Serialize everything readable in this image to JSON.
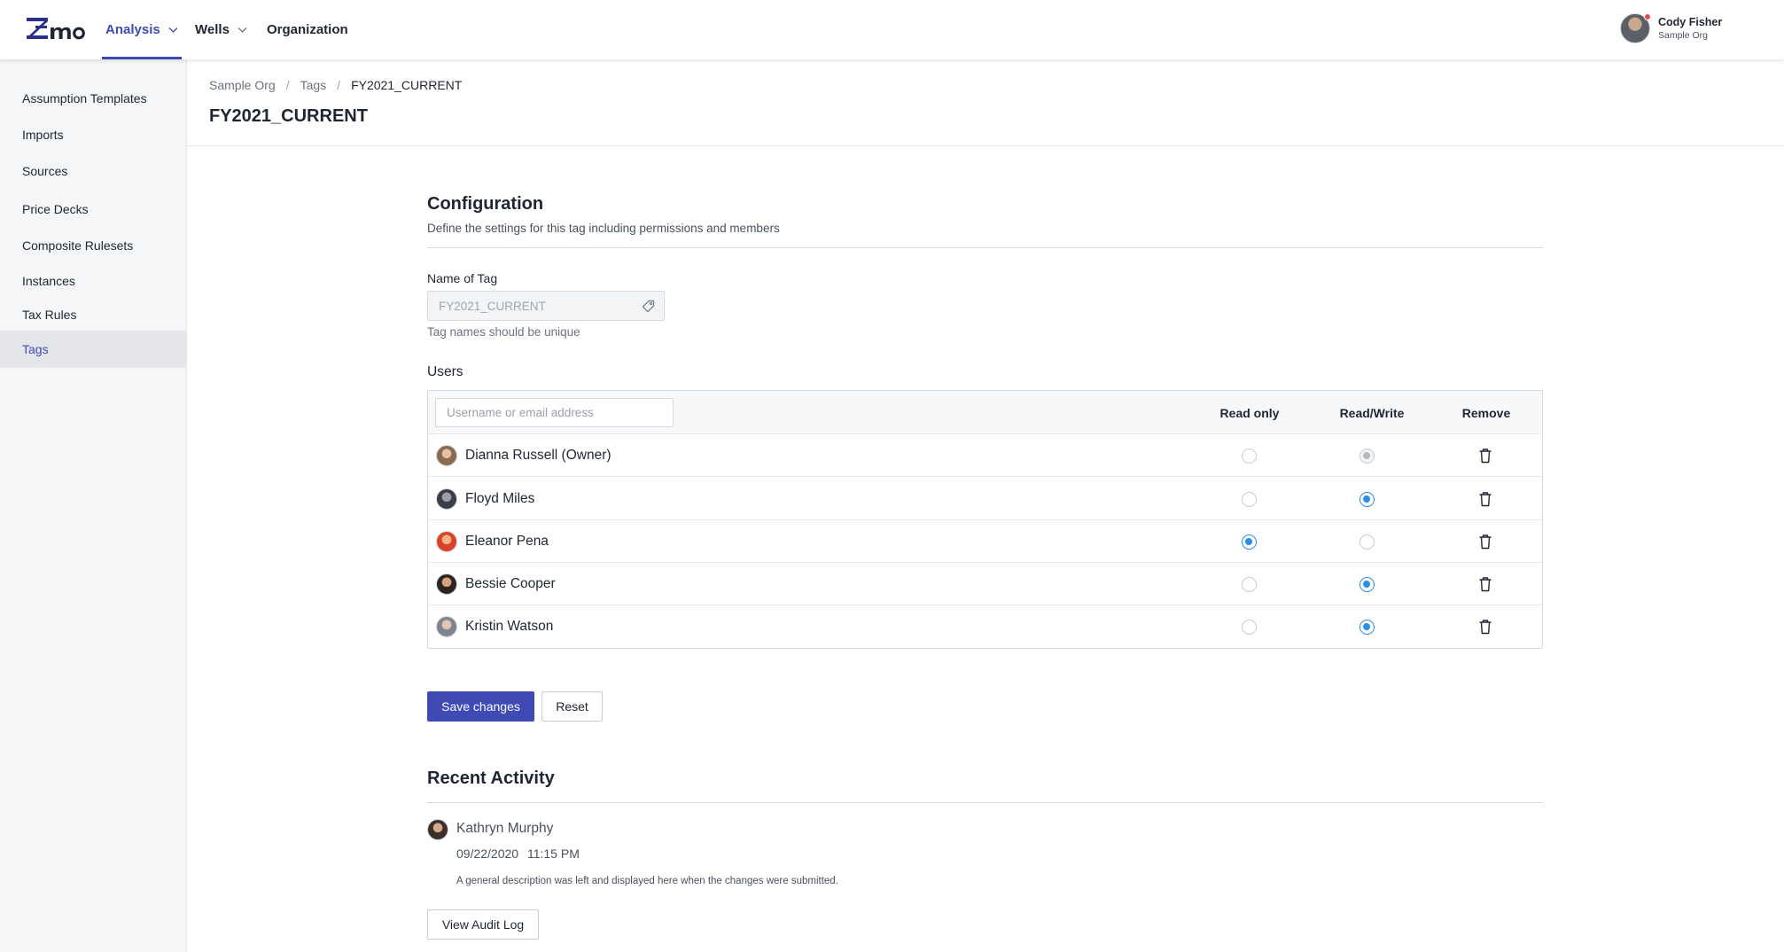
{
  "brand": {
    "logo_text": "ZEMO",
    "accent": "#3f4ab5"
  },
  "nav": {
    "items": [
      {
        "label": "Analysis",
        "has_dropdown": true,
        "active": true
      },
      {
        "label": "Wells",
        "has_dropdown": true,
        "active": false
      },
      {
        "label": "Organization",
        "has_dropdown": false,
        "active": false
      }
    ]
  },
  "user": {
    "name": "Cody Fisher",
    "org": "Sample Org",
    "has_notification": true
  },
  "sidebar": {
    "items": [
      {
        "label": "Assumption Templates",
        "active": false
      },
      {
        "label": "Imports",
        "active": false
      },
      {
        "label": "Sources",
        "active": false
      },
      {
        "label": "Price Decks",
        "active": false
      },
      {
        "label": "Composite Rulesets",
        "active": false
      },
      {
        "label": "Instances",
        "active": false
      },
      {
        "label": "Tax Rules",
        "active": false
      },
      {
        "label": "Tags",
        "active": true
      }
    ]
  },
  "breadcrumb": {
    "items": [
      "Sample Org",
      "Tags",
      "FY2021_CURRENT"
    ],
    "separator": "/"
  },
  "page": {
    "title": "FY2021_CURRENT"
  },
  "configuration": {
    "title": "Configuration",
    "subtitle": "Define the settings for this tag including permissions and members",
    "tag_name_label": "Name of Tag",
    "tag_name_value": "FY2021_CURRENT",
    "tag_name_hint": "Tag names should be unique",
    "users_label": "Users",
    "search_placeholder": "Username or email address",
    "columns": {
      "read_only": "Read only",
      "read_write": "Read/Write",
      "remove": "Remove"
    },
    "users": [
      {
        "name": "Dianna Russell (Owner)",
        "permission": "read_write",
        "locked": true
      },
      {
        "name": "Floyd Miles",
        "permission": "read_write",
        "locked": false
      },
      {
        "name": "Eleanor Pena",
        "permission": "read_only",
        "locked": false
      },
      {
        "name": "Bessie Cooper",
        "permission": "read_write",
        "locked": false
      },
      {
        "name": "Kristin Watson",
        "permission": "read_write",
        "locked": false
      }
    ],
    "save_label": "Save changes",
    "reset_label": "Reset"
  },
  "activity": {
    "title": "Recent Activity",
    "entries": [
      {
        "user": "Kathryn Murphy",
        "date": "09/22/2020",
        "time": "11:15 PM",
        "description": "A general description was left and displayed here when the changes were submitted."
      }
    ],
    "audit_label": "View Audit Log"
  },
  "colors": {
    "radio_on": "#2d8ce8",
    "radio_off_border": "#c8ccd3",
    "sidebar_bg": "#f5f6f8"
  }
}
